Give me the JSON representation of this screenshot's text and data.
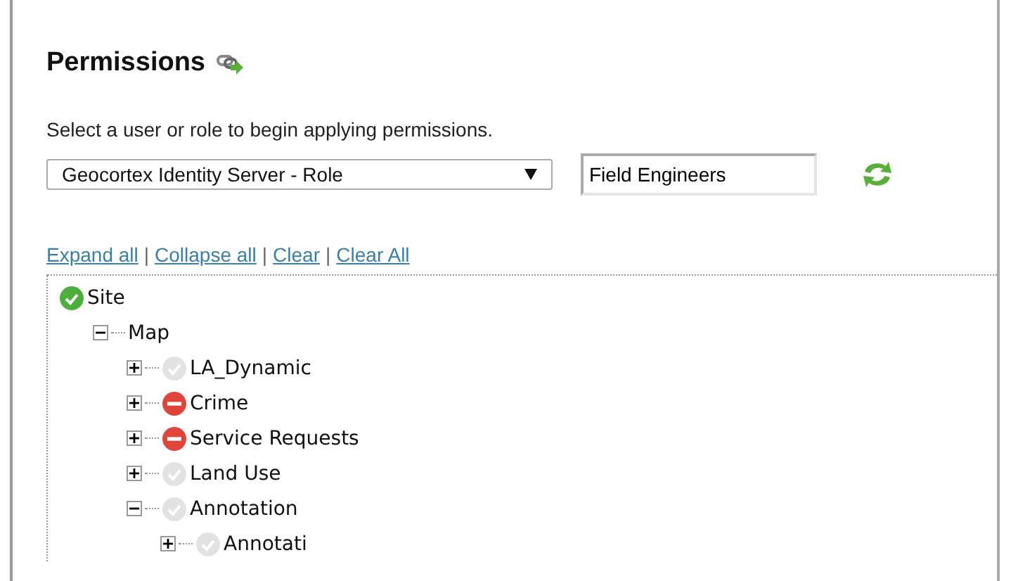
{
  "title": "Permissions",
  "instruction": "Select a user or role to begin applying permissions.",
  "provider_select": {
    "value": "Geocortex Identity Server - Role"
  },
  "role_field": {
    "value": "Field Engineers"
  },
  "links": [
    {
      "kind": "link",
      "text": "Expand all"
    },
    {
      "kind": "separator",
      "text": "|"
    },
    {
      "kind": "link",
      "text": "Collapse all"
    },
    {
      "kind": "separator",
      "text": "|"
    },
    {
      "kind": "link",
      "text": "Clear"
    },
    {
      "kind": "separator",
      "text": "|"
    },
    {
      "kind": "link",
      "text": "Clear All"
    }
  ],
  "tree": [
    {
      "label": "Site",
      "granted": true,
      "denied": false,
      "children": [
        {
          "label": "Map",
          "expanded": true,
          "children": [
            {
              "label": "LA_Dynamic",
              "granted": false,
              "denied": false,
              "expanded": false
            },
            {
              "label": "Crime",
              "denied": true,
              "expanded": false
            },
            {
              "label": "Service Requests",
              "denied": true,
              "expanded": false
            },
            {
              "label": "Land Use",
              "granted": false,
              "denied": false,
              "expanded": false
            },
            {
              "label": "Annotation",
              "granted": false,
              "denied": false,
              "expanded": true,
              "children": [
                {
                  "label": "Annotati",
                  "granted": false,
                  "denied": false,
                  "expanded": false
                }
              ]
            }
          ]
        }
      ]
    }
  ]
}
